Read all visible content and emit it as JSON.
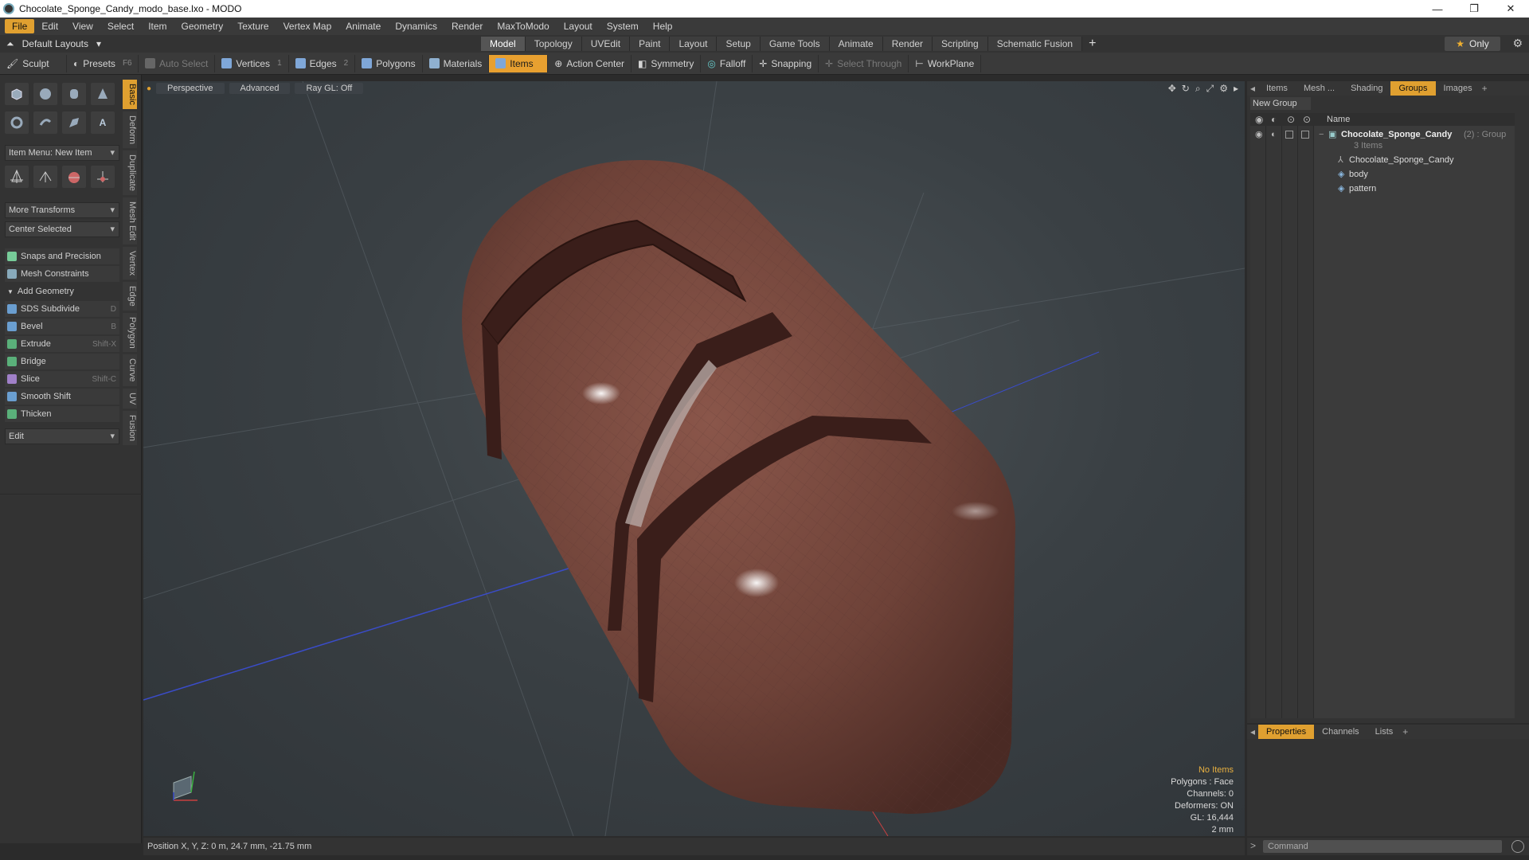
{
  "window": {
    "title": "Chocolate_Sponge_Candy_modo_base.lxo - MODO"
  },
  "menus": [
    "File",
    "Edit",
    "View",
    "Select",
    "Item",
    "Geometry",
    "Texture",
    "Vertex Map",
    "Animate",
    "Dynamics",
    "Render",
    "MaxToModo",
    "Layout",
    "System",
    "Help"
  ],
  "layout": {
    "dropdown": "Default Layouts",
    "only_label": "Only"
  },
  "tabs": [
    "Model",
    "Topology",
    "UVEdit",
    "Paint",
    "Layout",
    "Setup",
    "Game Tools",
    "Animate",
    "Render",
    "Scripting",
    "Schematic Fusion"
  ],
  "toolbar": {
    "sculpt": "Sculpt",
    "presets": "Presets",
    "presets_key": "F6",
    "auto_select": "Auto Select",
    "vertices": "Vertices",
    "vertices_key": "1",
    "edges": "Edges",
    "edges_key": "2",
    "polygons": "Polygons",
    "materials": "Materials",
    "items": "Items",
    "action_center": "Action Center",
    "symmetry": "Symmetry",
    "falloff": "Falloff",
    "snapping": "Snapping",
    "select_through": "Select Through",
    "workplane": "WorkPlane"
  },
  "left": {
    "item_menu": "Item Menu: New Item",
    "more_transforms": "More Transforms",
    "center_selected": "Center Selected",
    "snaps": "Snaps and Precision",
    "mesh_constraints": "Mesh Constraints",
    "add_geometry": "Add Geometry",
    "tools": [
      {
        "label": "SDS Subdivide",
        "shortcut": "D"
      },
      {
        "label": "Bevel",
        "shortcut": "B"
      },
      {
        "label": "Extrude",
        "shortcut": "Shift-X"
      },
      {
        "label": "Bridge",
        "shortcut": ""
      },
      {
        "label": "Slice",
        "shortcut": "Shift-C"
      },
      {
        "label": "Smooth Shift",
        "shortcut": ""
      },
      {
        "label": "Thicken",
        "shortcut": ""
      }
    ],
    "edit_dd": "Edit",
    "vtabs": [
      "Basic",
      "Deform",
      "Duplicate",
      "Mesh Edit",
      "Vertex",
      "Edge",
      "Polygon",
      "Curve",
      "UV",
      "Fusion"
    ]
  },
  "viewport": {
    "perspective": "Perspective",
    "advanced": "Advanced",
    "raygl": "Ray GL: Off",
    "info": {
      "no_items": "No Items",
      "polygons": "Polygons : Face",
      "channels": "Channels: 0",
      "deformers": "Deformers: ON",
      "gl": "GL: 16,444",
      "scale": "2 mm"
    }
  },
  "status": {
    "position": "Position X, Y, Z:   0 m, 24.7 mm, -21.75 mm"
  },
  "right": {
    "tabs": [
      "Items",
      "Mesh ...",
      "Shading",
      "Groups",
      "Images"
    ],
    "new_group": "New Group",
    "col_name": "Name",
    "group_name": "Chocolate_Sponge_Candy",
    "group_suffix": "(2) : Group",
    "group_count": "3 Items",
    "children": [
      "Chocolate_Sponge_Candy",
      "body",
      "pattern"
    ]
  },
  "props": {
    "tabs": [
      "Properties",
      "Channels",
      "Lists"
    ]
  },
  "command": {
    "placeholder": "Command"
  },
  "colors": {
    "accent": "#e0a030",
    "chocolate": "#7a4a40"
  }
}
